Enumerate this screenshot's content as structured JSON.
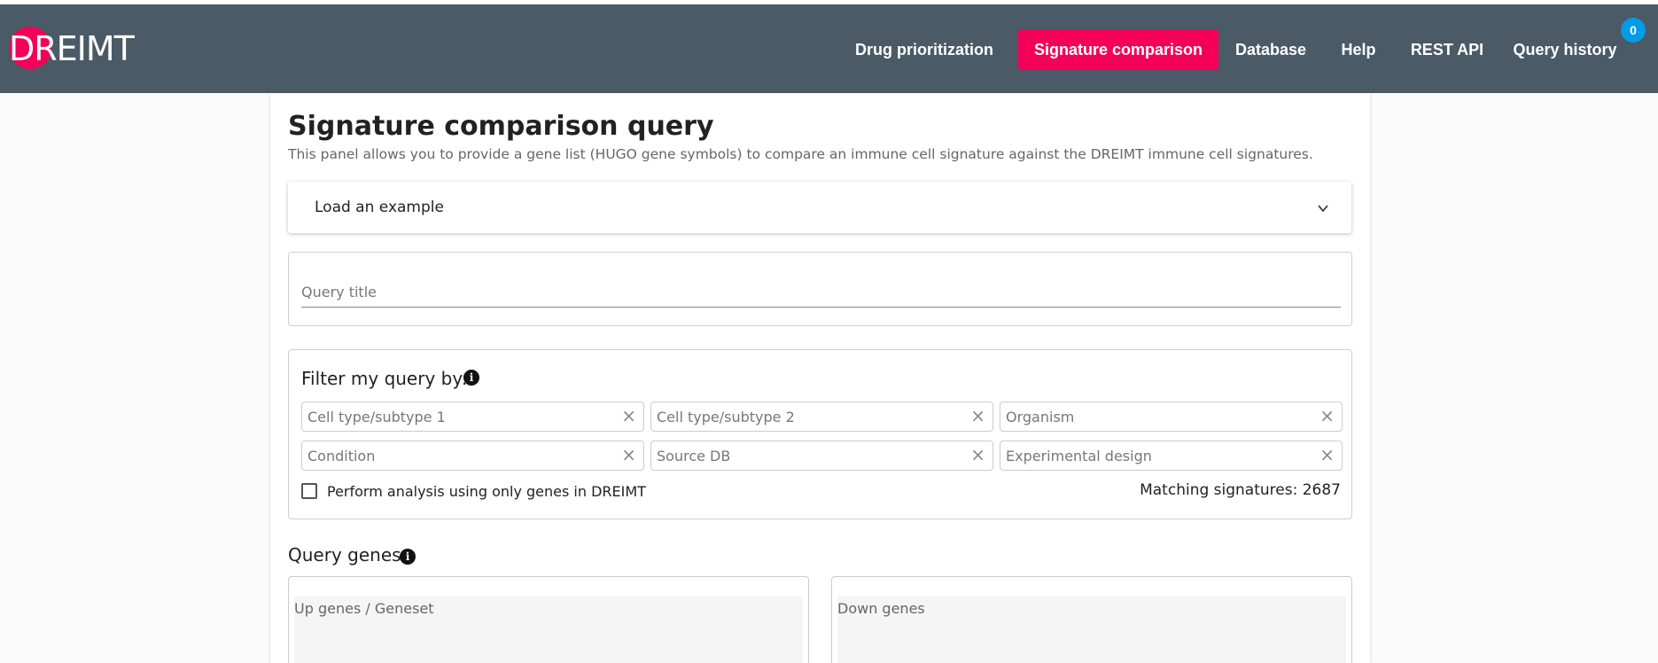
{
  "app": {
    "logo_text": "DREIMT"
  },
  "nav": {
    "items": [
      {
        "label": "Drug prioritization",
        "active": false
      },
      {
        "label": "Signature comparison",
        "active": true
      },
      {
        "label": "Database",
        "active": false
      },
      {
        "label": "Help",
        "active": false
      },
      {
        "label": "REST API",
        "active": false
      },
      {
        "label": "Query history",
        "active": false
      }
    ],
    "history_badge": "0"
  },
  "page": {
    "title": "Signature comparison query",
    "subtitle": "This panel allows you to provide a gene list (HUGO gene symbols) to compare an immune cell signature against the DREIMT immune cell signatures."
  },
  "example_panel": {
    "label": "Load an example"
  },
  "query_title": {
    "placeholder": "Query title"
  },
  "filters": {
    "title": "Filter my query by:",
    "selects": [
      {
        "label": "Cell type/subtype 1"
      },
      {
        "label": "Cell type/subtype 2"
      },
      {
        "label": "Organism"
      },
      {
        "label": "Condition"
      },
      {
        "label": "Source DB"
      },
      {
        "label": "Experimental design"
      }
    ],
    "only_dreimt_genes_label": "Perform analysis using only genes in DREIMT",
    "only_dreimt_genes_checked": false,
    "matching_label": "Matching signatures: 2687"
  },
  "genes": {
    "title": "Query genes",
    "up_placeholder": "Up genes / Geneset",
    "down_placeholder": "Down genes"
  },
  "colors": {
    "navbar": "#4a5a66",
    "accent": "#f50057",
    "badge": "#039be5"
  }
}
